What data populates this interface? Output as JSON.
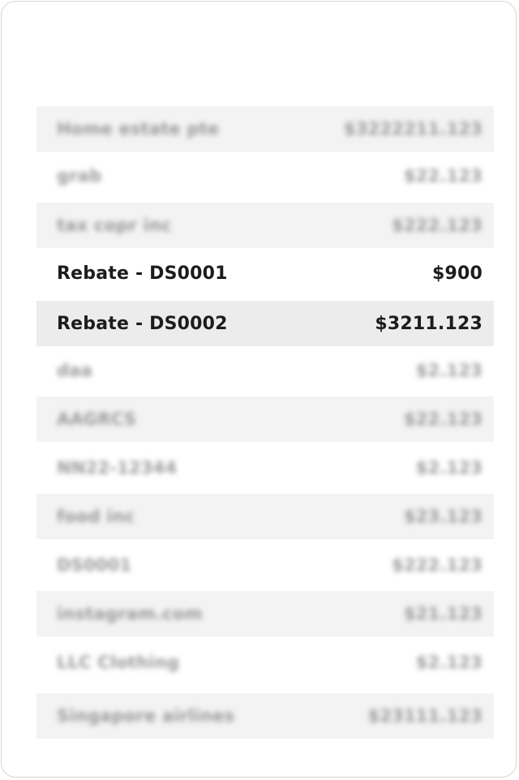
{
  "transactions": [
    {
      "label": "Home estate pte",
      "amount": "$3222211.123",
      "blurred": true,
      "shaded": true
    },
    {
      "label": "grab",
      "amount": "$22.123",
      "blurred": true,
      "shaded": false
    },
    {
      "label": "tax copr inc",
      "amount": "$222.123",
      "blurred": true,
      "shaded": true
    },
    {
      "label": "Rebate - DS0001",
      "amount": "$900",
      "blurred": false,
      "shaded": false
    },
    {
      "label": "Rebate - DS0002",
      "amount": "$3211.123",
      "blurred": false,
      "shaded": true
    },
    {
      "label": "daa",
      "amount": "$2.123",
      "blurred": true,
      "shaded": false
    },
    {
      "label": "AAGRCS",
      "amount": "$22.123",
      "blurred": true,
      "shaded": true
    },
    {
      "label": "NN22-12344",
      "amount": "$2.123",
      "blurred": true,
      "shaded": false
    },
    {
      "label": "food inc",
      "amount": "$23.123",
      "blurred": true,
      "shaded": true
    },
    {
      "label": "DS0001",
      "amount": "$222.123",
      "blurred": true,
      "shaded": false
    },
    {
      "label": "instagram.com",
      "amount": "$21.123",
      "blurred": true,
      "shaded": true
    },
    {
      "label": "LLC Clothing",
      "amount": "$2.123",
      "blurred": true,
      "shaded": false
    },
    {
      "label": "Singapore airlines",
      "amount": "$23111.123",
      "blurred": true,
      "shaded": true
    }
  ]
}
